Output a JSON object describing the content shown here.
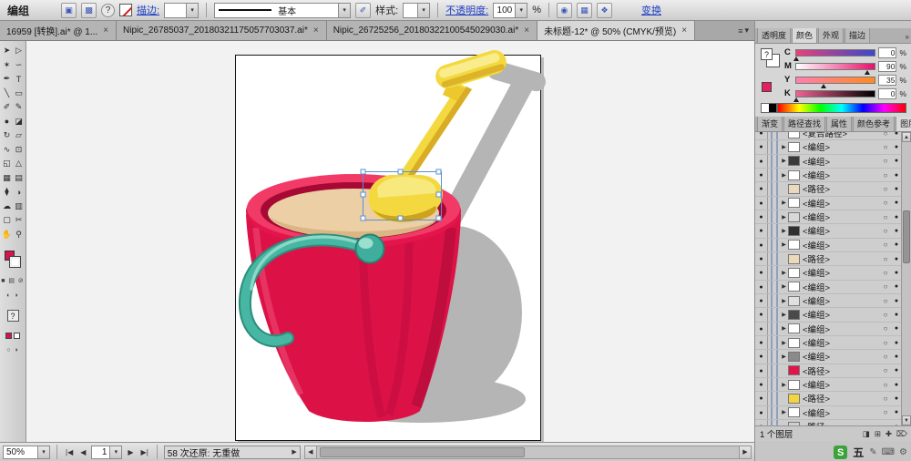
{
  "control_bar": {
    "title": "编组",
    "help": "?",
    "stroke_label": "描边:",
    "brush_basic": "基本",
    "style_label": "样式:",
    "opacity_label": "不透明度:",
    "opacity_value": "100",
    "percent": "%",
    "transform_link": "变换"
  },
  "doc_tabs": [
    {
      "title": "16959 [转换].ai* @ 1...",
      "active": false
    },
    {
      "title": "Nipic_26785037_20180321175057703037.ai*",
      "active": false
    },
    {
      "title": "Nipic_26725256_20180322100545029030.ai*",
      "active": false
    },
    {
      "title": "未标题-12* @ 50% (CMYK/预览)",
      "active": true
    }
  ],
  "tools": [
    {
      "name": "selection-tool",
      "glyph": "➤"
    },
    {
      "name": "direct-selection-tool",
      "glyph": "▷"
    },
    {
      "name": "magic-wand-tool",
      "glyph": "✶"
    },
    {
      "name": "lasso-tool",
      "glyph": "∽"
    },
    {
      "name": "pen-tool",
      "glyph": "✒"
    },
    {
      "name": "type-tool",
      "glyph": "T"
    },
    {
      "name": "line-segment-tool",
      "glyph": "╲"
    },
    {
      "name": "rectangle-tool",
      "glyph": "▭"
    },
    {
      "name": "paintbrush-tool",
      "glyph": "✐"
    },
    {
      "name": "pencil-tool",
      "glyph": "✎"
    },
    {
      "name": "blob-brush-tool",
      "glyph": "●"
    },
    {
      "name": "eraser-tool",
      "glyph": "◪"
    },
    {
      "name": "rotate-tool",
      "glyph": "↻"
    },
    {
      "name": "scale-tool",
      "glyph": "▱"
    },
    {
      "name": "width-tool",
      "glyph": "∿"
    },
    {
      "name": "free-transform-tool",
      "glyph": "⊡"
    },
    {
      "name": "shape-builder-tool",
      "glyph": "◱"
    },
    {
      "name": "perspective-grid-tool",
      "glyph": "△"
    },
    {
      "name": "mesh-tool",
      "glyph": "▦"
    },
    {
      "name": "gradient-tool",
      "glyph": "▤"
    },
    {
      "name": "eyedropper-tool",
      "glyph": "⧫"
    },
    {
      "name": "blend-tool",
      "glyph": "◑"
    },
    {
      "name": "symbol-sprayer-tool",
      "glyph": "☁"
    },
    {
      "name": "column-graph-tool",
      "glyph": "▥"
    },
    {
      "name": "artboard-tool",
      "glyph": "▢"
    },
    {
      "name": "slice-tool",
      "glyph": "✂"
    },
    {
      "name": "hand-tool",
      "glyph": "✋"
    },
    {
      "name": "zoom-tool",
      "glyph": "⚲"
    }
  ],
  "color_panel": {
    "tabs": [
      {
        "label": "透明度",
        "active": false
      },
      {
        "label": "颜色",
        "active": true
      },
      {
        "label": "外观",
        "active": false
      },
      {
        "label": "描边",
        "active": false
      }
    ],
    "proxy_fill": "?",
    "channels": [
      {
        "label": "C",
        "value": "0"
      },
      {
        "label": "M",
        "value": "90"
      },
      {
        "label": "Y",
        "value": "35"
      },
      {
        "label": "K",
        "value": "0"
      }
    ],
    "percent": "%"
  },
  "layers_panel": {
    "tabs": [
      {
        "label": "渐变",
        "active": false
      },
      {
        "label": "路径查找",
        "active": false
      },
      {
        "label": "属性",
        "active": false
      },
      {
        "label": "颜色参考",
        "active": false
      },
      {
        "label": "图层",
        "active": true
      }
    ],
    "rows": [
      {
        "label": "<复合路径>",
        "expand": false,
        "thumb": "#ffffff"
      },
      {
        "label": "<编组>",
        "expand": true,
        "thumb": "#ffffff"
      },
      {
        "label": "<编组>",
        "expand": true,
        "thumb": "#3a3a3a"
      },
      {
        "label": "<编组>",
        "expand": true,
        "thumb": "#ffffff"
      },
      {
        "label": "<路径>",
        "expand": false,
        "thumb": "#ead9bd"
      },
      {
        "label": "<编组>",
        "expand": true,
        "thumb": "#ffffff"
      },
      {
        "label": "<编组>",
        "expand": true,
        "thumb": "#d8d8d8"
      },
      {
        "label": "<编组>",
        "expand": true,
        "thumb": "#2f2f2f"
      },
      {
        "label": "<编组>",
        "expand": true,
        "thumb": "#ffffff"
      },
      {
        "label": "<路径>",
        "expand": false,
        "thumb": "#ecd9b8"
      },
      {
        "label": "<编组>",
        "expand": true,
        "thumb": "#ffffff"
      },
      {
        "label": "<编组>",
        "expand": true,
        "thumb": "#ffffff"
      },
      {
        "label": "<编组>",
        "expand": true,
        "thumb": "#e0e0e0"
      },
      {
        "label": "<编组>",
        "expand": true,
        "thumb": "#4a4a4a"
      },
      {
        "label": "<编组>",
        "expand": true,
        "thumb": "#ffffff"
      },
      {
        "label": "<编组>",
        "expand": true,
        "thumb": "#ffffff"
      },
      {
        "label": "<编组>",
        "expand": true,
        "thumb": "#8a8a8a"
      },
      {
        "label": "<路径>",
        "expand": false,
        "thumb": "#e0154a"
      },
      {
        "label": "<编组>",
        "expand": true,
        "thumb": "#ffffff"
      },
      {
        "label": "<路径>",
        "expand": false,
        "thumb": "#f2d541"
      },
      {
        "label": "<编组>",
        "expand": true,
        "thumb": "#ffffff"
      },
      {
        "label": "<路径>",
        "expand": false,
        "thumb": "#d0d0d0"
      }
    ],
    "footer": "1 个图层"
  },
  "status_bar": {
    "zoom": "50%",
    "artboard": "1",
    "undo_text": "58 次还原: 无重做"
  },
  "ime": {
    "logo": "S",
    "label": "五"
  },
  "artwork_colors": {
    "bucket_red": "#dc1247",
    "rim_red": "#e4144c",
    "sand_tan": "#eccfa4",
    "shovel_yellow": "#f3d93f",
    "handle_teal": "#47b6a2",
    "shadow_gray": "#b5b5b5",
    "selection_blue": "#5a8fd6"
  },
  "icons": {
    "close": "×",
    "dropdown": "▾",
    "menu": "≡",
    "collapse": "»",
    "eye": "●",
    "expand": "▶",
    "target": "○",
    "meatball": "●",
    "nav_first": "|◀",
    "nav_prev": "◀",
    "nav_next": "▶",
    "nav_last": "▶|",
    "scroll_left": "◀",
    "scroll_right": "▶",
    "scroll_up": "▲",
    "scroll_down": "▼",
    "undo_play": "▶",
    "cb_icon1": "▣",
    "cb_icon2": "▩",
    "cb_brush": "✐",
    "cb_icon3": "◉",
    "cb_icon4": "▦",
    "cb_icon5": "❖",
    "tb_mini": "■ ▤ ⊘",
    "tb_modes": "◐ ◑",
    "tb_q": "?",
    "tb_circles": "○ ◑",
    "footer_icons": [
      "◨",
      "⊞",
      "✚",
      "⌦"
    ],
    "ime_icons": [
      "✎",
      "⌨",
      "⚙"
    ]
  }
}
